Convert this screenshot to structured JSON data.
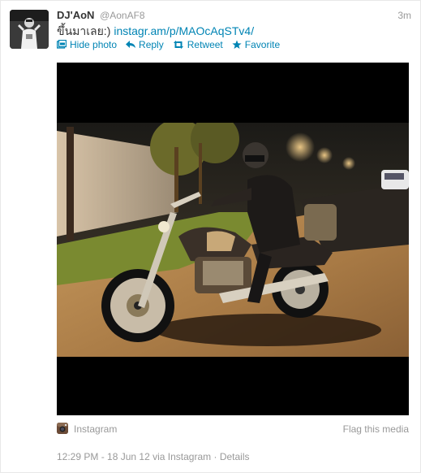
{
  "tweet": {
    "fullname": "DJ'AoN",
    "username": "@AonAF8",
    "timestamp": "3m",
    "text": "ขึ้นมาเลย:)",
    "link": "instagr.am/p/MAOcAqSTv4/"
  },
  "actions": {
    "hide_photo": "Hide photo",
    "reply": "Reply",
    "retweet": "Retweet",
    "favorite": "Favorite"
  },
  "media_footer": {
    "source": "Instagram",
    "flag": "Flag this media"
  },
  "meta": {
    "date": "12:29 PM - 18 Jun 12",
    "via": "via Instagram",
    "sep": "·",
    "details": "Details"
  },
  "icons": {
    "hide_photo": "photo-icon",
    "reply": "reply-arrow-icon",
    "retweet": "retweet-icon",
    "favorite": "star-icon",
    "source": "instagram-camera-icon"
  },
  "colors": {
    "link": "#0084b4",
    "muted": "#999999",
    "text": "#333333"
  }
}
